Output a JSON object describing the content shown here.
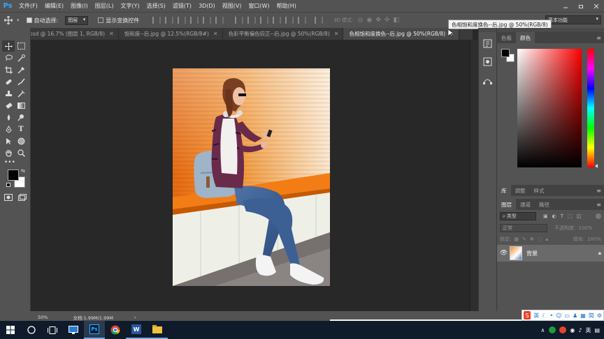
{
  "app": {
    "logo": "Ps",
    "accent": "#31a8ff"
  },
  "menus": [
    "文件(F)",
    "编辑(E)",
    "图像(I)",
    "图层(L)",
    "文字(Y)",
    "选择(S)",
    "滤镜(T)",
    "3D(D)",
    "视图(V)",
    "窗口(W)",
    "帮助(H)"
  ],
  "window_controls": [
    "minimize-icon",
    "restore-icon",
    "close-icon"
  ],
  "options": {
    "auto_select_label": "自动选择:",
    "auto_select_value": "图层",
    "show_transform_label": "显示变换控件",
    "mode_3d_label": "3D 模式:",
    "workspace": "基本功能"
  },
  "tabs": [
    {
      "label": "08.psd @ 16.7% (图层 1, RGB/8)",
      "active": false
    },
    {
      "label": "饱和度--后.jpg @ 12.5%(RGB/8#)",
      "active": false
    },
    {
      "label": "色彩平衡偏色较正--后.jpg @ 50%(RGB/8)",
      "active": false
    },
    {
      "label": "色相饱和度换色--后.jpg @ 50%(RGB/8)",
      "active": true
    }
  ],
  "tooltip": "色相饱和度换色--后.jpg @ 50%(RGB/8)",
  "tools": [
    "move-tool-icon",
    "marquee-tool-icon",
    "lasso-tool-icon",
    "quick-select-tool-icon",
    "crop-tool-icon",
    "eyedropper-tool-icon",
    "healing-brush-tool-icon",
    "brush-tool-icon",
    "clone-stamp-tool-icon",
    "history-brush-tool-icon",
    "eraser-tool-icon",
    "gradient-tool-icon",
    "blur-tool-icon",
    "dodge-tool-icon",
    "pen-tool-icon",
    "type-tool-icon",
    "path-select-tool-icon",
    "shape-tool-icon",
    "hand-tool-icon",
    "zoom-tool-icon"
  ],
  "type_tool_glyph": "T",
  "swatches": {
    "foreground": "#000000",
    "background": "#ffffff"
  },
  "color_panel": {
    "tabs": [
      "色板",
      "颜色"
    ],
    "active": "颜色",
    "hue": "#ff0000"
  },
  "mid_panel": {
    "tabs": [
      "库",
      "调整",
      "样式"
    ],
    "active": "库"
  },
  "layers_panel": {
    "tabs": [
      "图层",
      "通道",
      "路径"
    ],
    "active": "图层",
    "filter_label": "类型",
    "blend_mode": "正常",
    "opacity_label": "不透明度:",
    "opacity_value": "100%",
    "lock_label": "锁定:",
    "fill_label": "填充:",
    "fill_value": "100%",
    "layers": [
      {
        "name": "背景",
        "visible": true,
        "locked": true
      }
    ]
  },
  "status": {
    "zoom": "50%",
    "doc_info": "文档:1.99M/1.99M"
  },
  "taskbar": {
    "items": [
      "windows-start-icon",
      "search-icon",
      "task-view-icon",
      "remote-desktop-icon",
      "photoshop-icon",
      "chrome-icon",
      "word-icon",
      "file-explorer-icon"
    ],
    "photoshop_label": "Ps",
    "word_label": "W",
    "tray_lang": "英",
    "tray_glyphs": {
      "chevron": "∧",
      "ime_lang": "英",
      "notify": "▤"
    }
  },
  "ime": {
    "label": "英",
    "icons": [
      "moon-icon",
      "half-width-icon",
      "emoji-icon",
      "keyboard-icon",
      "skin-icon",
      "grid-icon",
      "simplified-icon",
      "settings-icon"
    ],
    "simplified_glyph": "简"
  }
}
